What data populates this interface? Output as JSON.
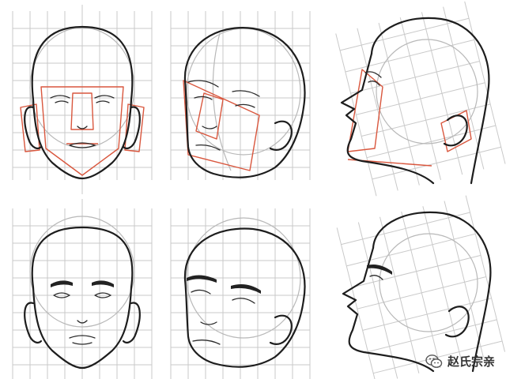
{
  "figure": {
    "panels": [
      {
        "row": "top",
        "view": "front",
        "construction_lines": true
      },
      {
        "row": "top",
        "view": "three-quarter",
        "construction_lines": true
      },
      {
        "row": "top",
        "view": "profile-up",
        "construction_lines": true
      },
      {
        "row": "bottom",
        "view": "front",
        "construction_lines": false
      },
      {
        "row": "bottom",
        "view": "three-quarter",
        "construction_lines": false
      },
      {
        "row": "bottom",
        "view": "profile-up",
        "construction_lines": false
      }
    ],
    "colors": {
      "ink": "#1d1d1d",
      "grid": "#c9c9c9",
      "construction": "#d9573e"
    }
  },
  "watermark": {
    "icon": "wechat-logo-icon",
    "text": "赵氏宗亲"
  }
}
